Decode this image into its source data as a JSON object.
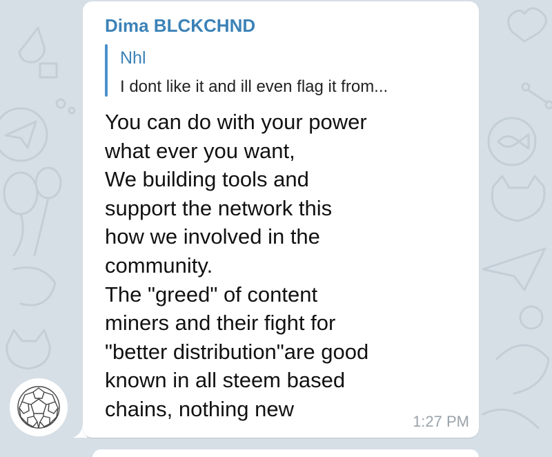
{
  "message": {
    "sender": "Dima BLCKCHND",
    "reply": {
      "author": "Nhl",
      "text": "I dont like it and ill even flag it from..."
    },
    "lines": [
      "You can do with your power",
      "what ever you want,",
      "We building tools and",
      "support the network this",
      "how we involved in the",
      "community.",
      "The \"greed\" of content",
      "miners and their fight for",
      "\"better distribution\"are good",
      "known in all steem based",
      "chains, nothing new"
    ],
    "time": "1:27 PM"
  },
  "colors": {
    "background": "#d6dfe6",
    "bubble": "#ffffff",
    "sender_name": "#3b82b7",
    "reply_bar": "#4a90cc",
    "timestamp": "#9aa3ab"
  },
  "icons": {
    "avatar": "buckyball-avatar-icon",
    "background_doodles": "chat-wallpaper-doodle-icons"
  }
}
